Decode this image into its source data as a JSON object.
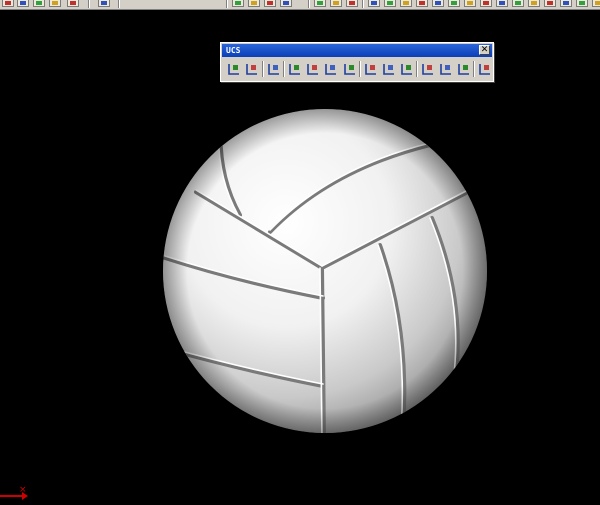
{
  "window": {
    "title": "UCS",
    "close_symbol": "✕"
  },
  "ucs_toolbar": {
    "buttons": [
      {
        "name": "ucs-icon"
      },
      {
        "name": "display-ucs-dialog-icon"
      },
      {
        "name": "ucs-previous-icon"
      },
      {
        "name": "world-ucs-icon"
      },
      {
        "name": "object-ucs-icon"
      },
      {
        "name": "face-ucs-icon"
      },
      {
        "name": "view-ucs-icon"
      },
      {
        "name": "origin-ucs-icon"
      },
      {
        "name": "z-axis-vector-ucs-icon"
      },
      {
        "name": "3-point-ucs-icon"
      },
      {
        "name": "x-axis-rotate-ucs-icon"
      },
      {
        "name": "y-axis-rotate-ucs-icon"
      },
      {
        "name": "z-axis-rotate-ucs-icon"
      },
      {
        "name": "apply-ucs-icon"
      }
    ]
  },
  "viewport": {
    "background": "#000000",
    "model": "volleyball-3d-render",
    "ucs_icon_color": "#d00000",
    "ucs_axis_label": "×"
  }
}
